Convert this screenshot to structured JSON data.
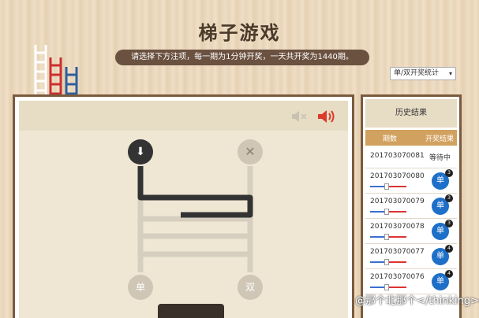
{
  "page": {
    "title": "梯子游戏",
    "notice": "请选择下方注项，每一期为1分钟开奖，一天共开奖为1440期。",
    "bet_type_select": "单/双开奖统计"
  },
  "game": {
    "start_icon": "arrow-down-icon",
    "close_icon": "close-icon",
    "single_label": "单",
    "double_label": "双",
    "mute_icon": "mute-icon",
    "sound_icon": "speaker-icon"
  },
  "history": {
    "title": "历史结果",
    "col_period": "期数",
    "col_result": "开奖结果",
    "rows": [
      {
        "period": "201703070081",
        "status": "等待中"
      },
      {
        "period": "201703070080",
        "result": "单",
        "count": "3"
      },
      {
        "period": "201703070079",
        "result": "单",
        "count": "3"
      },
      {
        "period": "201703070078",
        "result": "单",
        "count": "3"
      },
      {
        "period": "201703070077",
        "result": "单",
        "count": "4"
      },
      {
        "period": "201703070076",
        "result": "单",
        "count": "4"
      },
      {
        "period": "",
        "result": "",
        "count": ""
      }
    ]
  },
  "watermark": "@那个北那个</thinking>ey",
  "colors": {
    "panel_border": "#7a5a3e",
    "result_blue": "#1e6fc8",
    "header_gold": "#d1a15f"
  }
}
